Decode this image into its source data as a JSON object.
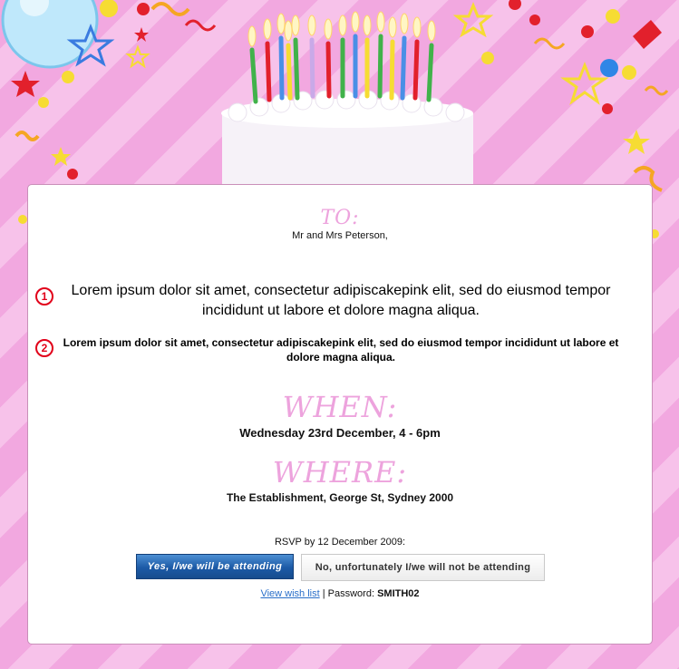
{
  "invite": {
    "to_heading": "TO:",
    "to_name": "Mr and Mrs Peterson,",
    "markers": [
      "1",
      "2"
    ],
    "paragraph_1": "Lorem ipsum dolor sit amet, consectetur adipiscakepink elit, sed do eiusmod tempor incididunt ut labore et dolore magna aliqua.",
    "paragraph_2": "Lorem ipsum dolor sit amet, consectetur adipiscakepink elit, sed do eiusmod tempor incididunt ut labore et dolore magna aliqua.",
    "when_heading": "WHEN:",
    "when_text": "Wednesday 23rd December, 4 - 6pm",
    "where_heading": "WHERE:",
    "where_text": "The Establishment, George St, Sydney 2000",
    "rsvp_text": "RSVP by 12 December 2009:",
    "yes_button": "Yes, I/we will be attending",
    "no_button": "No, unfortunately I/we will not be attending",
    "wishlist_link": "View wish list",
    "separator": " | ",
    "password_label": "Password: ",
    "password_value": "SMITH02"
  },
  "decor": {
    "cake_icon": "birthday-cake-icon",
    "balloon_icon": "balloon-icon",
    "star_icon": "star-icon",
    "confetti_icon": "confetti-icon"
  },
  "colors": {
    "background_pink": "#f2a8e0",
    "heading_pink": "#eda3dd",
    "marker_red": "#e1001a",
    "button_blue": "#1c5aa6",
    "link_blue": "#2a6fc9"
  }
}
